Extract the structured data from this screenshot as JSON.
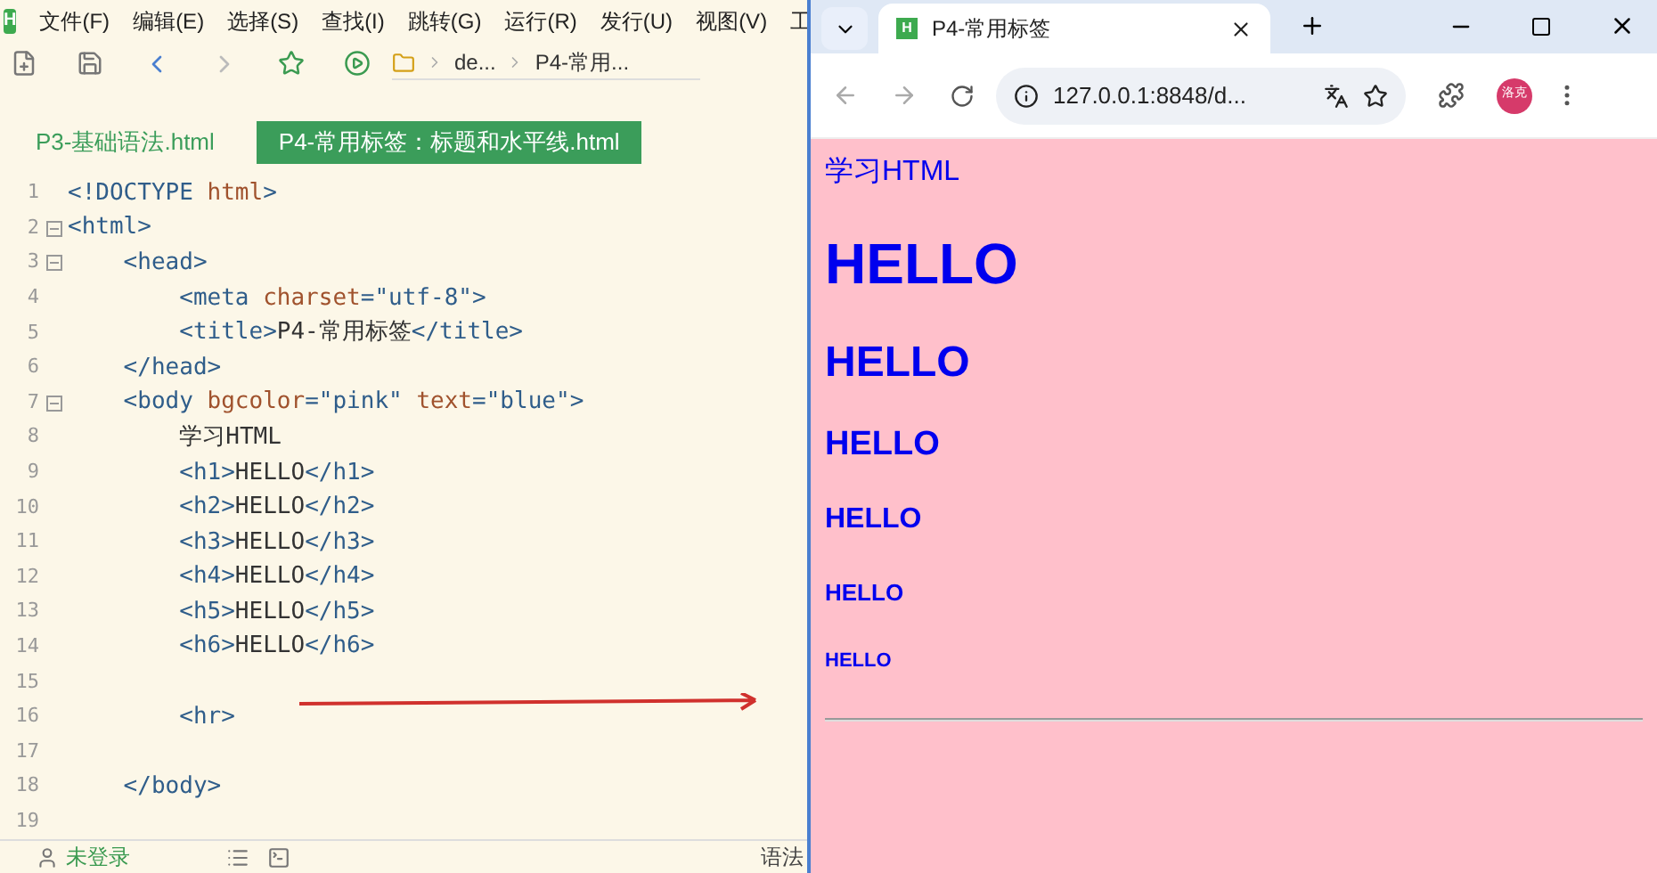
{
  "editor": {
    "logo": "H",
    "menu": [
      "文件(F)",
      "编辑(E)",
      "选择(S)",
      "查找(I)",
      "跳转(G)",
      "运行(R)",
      "发行(U)",
      "视图(V)",
      "工"
    ],
    "breadcrumb": [
      "de...",
      "P4-常用..."
    ],
    "tabs": [
      {
        "label": "P3-基础语法.html",
        "selected": false
      },
      {
        "label": "P4-常用标签：标题和水平线.html",
        "selected": true
      }
    ],
    "lines": [
      {
        "number": "1",
        "fold": false,
        "tokens": [
          {
            "kind": "tag",
            "text": "<!DOCTYPE "
          },
          {
            "kind": "attr",
            "text": "html"
          },
          {
            "kind": "tag",
            "text": ">"
          }
        ]
      },
      {
        "number": "2",
        "fold": true,
        "tokens": [
          {
            "kind": "tag",
            "text": "<html>"
          }
        ]
      },
      {
        "number": "3",
        "fold": true,
        "tokens": [
          {
            "kind": "tag",
            "text": "    <head>"
          }
        ]
      },
      {
        "number": "4",
        "fold": false,
        "tokens": [
          {
            "kind": "tag",
            "text": "        <meta "
          },
          {
            "kind": "attr",
            "text": "charset"
          },
          {
            "kind": "tag",
            "text": "="
          },
          {
            "kind": "value",
            "text": "\"utf-8\""
          },
          {
            "kind": "tag",
            "text": ">"
          }
        ]
      },
      {
        "number": "5",
        "fold": false,
        "tokens": [
          {
            "kind": "tag",
            "text": "        <title>"
          },
          {
            "kind": "text",
            "text": "P4-常用标签"
          },
          {
            "kind": "tag",
            "text": "</title>"
          }
        ]
      },
      {
        "number": "6",
        "fold": false,
        "tokens": [
          {
            "kind": "tag",
            "text": "    </head>"
          }
        ]
      },
      {
        "number": "7",
        "fold": true,
        "tokens": [
          {
            "kind": "tag",
            "text": "    <body "
          },
          {
            "kind": "attr",
            "text": "bgcolor"
          },
          {
            "kind": "tag",
            "text": "="
          },
          {
            "kind": "value",
            "text": "\"pink\" "
          },
          {
            "kind": "attr",
            "text": "text"
          },
          {
            "kind": "tag",
            "text": "="
          },
          {
            "kind": "value",
            "text": "\"blue\""
          },
          {
            "kind": "tag",
            "text": ">"
          }
        ]
      },
      {
        "number": "8",
        "fold": false,
        "tokens": [
          {
            "kind": "text",
            "text": "        学习HTML"
          }
        ]
      },
      {
        "number": "9",
        "fold": false,
        "tokens": [
          {
            "kind": "tag",
            "text": "        <h1>"
          },
          {
            "kind": "text",
            "text": "HELLO"
          },
          {
            "kind": "tag",
            "text": "</h1>"
          }
        ]
      },
      {
        "number": "10",
        "fold": false,
        "tokens": [
          {
            "kind": "tag",
            "text": "        <h2>"
          },
          {
            "kind": "text",
            "text": "HELLO"
          },
          {
            "kind": "tag",
            "text": "</h2>"
          }
        ]
      },
      {
        "number": "11",
        "fold": false,
        "tokens": [
          {
            "kind": "tag",
            "text": "        <h3>"
          },
          {
            "kind": "text",
            "text": "HELLO"
          },
          {
            "kind": "tag",
            "text": "</h3>"
          }
        ]
      },
      {
        "number": "12",
        "fold": false,
        "tokens": [
          {
            "kind": "tag",
            "text": "        <h4>"
          },
          {
            "kind": "text",
            "text": "HELLO"
          },
          {
            "kind": "tag",
            "text": "</h4>"
          }
        ]
      },
      {
        "number": "13",
        "fold": false,
        "tokens": [
          {
            "kind": "tag",
            "text": "        <h5>"
          },
          {
            "kind": "text",
            "text": "HELLO"
          },
          {
            "kind": "tag",
            "text": "</h5>"
          }
        ]
      },
      {
        "number": "14",
        "fold": false,
        "tokens": [
          {
            "kind": "tag",
            "text": "        <h6>"
          },
          {
            "kind": "text",
            "text": "HELLO"
          },
          {
            "kind": "tag",
            "text": "</h6>"
          }
        ]
      },
      {
        "number": "15",
        "fold": false
      },
      {
        "number": "16",
        "fold": false,
        "tokens": [
          {
            "kind": "tag",
            "text": "        <hr>"
          }
        ]
      },
      {
        "number": "17",
        "fold": false
      },
      {
        "number": "18",
        "fold": false,
        "tokens": [
          {
            "kind": "tag",
            "text": "    </body>"
          }
        ]
      },
      {
        "number": "19",
        "fold": false
      }
    ],
    "status_bar": {
      "login": "未登录",
      "right": "语法"
    }
  },
  "browser": {
    "tab": {
      "favicon": "H",
      "title": "P4-常用标签"
    },
    "url": "127.0.0.1:8848/d...",
    "avatar": "洛克",
    "page": {
      "text": "学习HTML",
      "headings": [
        {
          "kind": "h1",
          "text": "HELLO"
        },
        {
          "kind": "h2",
          "text": "HELLO"
        },
        {
          "kind": "h3",
          "text": "HELLO"
        },
        {
          "kind": "h4",
          "text": "HELLO"
        },
        {
          "kind": "h5",
          "text": "HELLO"
        },
        {
          "kind": "h6",
          "text": "HELLO"
        }
      ],
      "rule": true
    }
  }
}
